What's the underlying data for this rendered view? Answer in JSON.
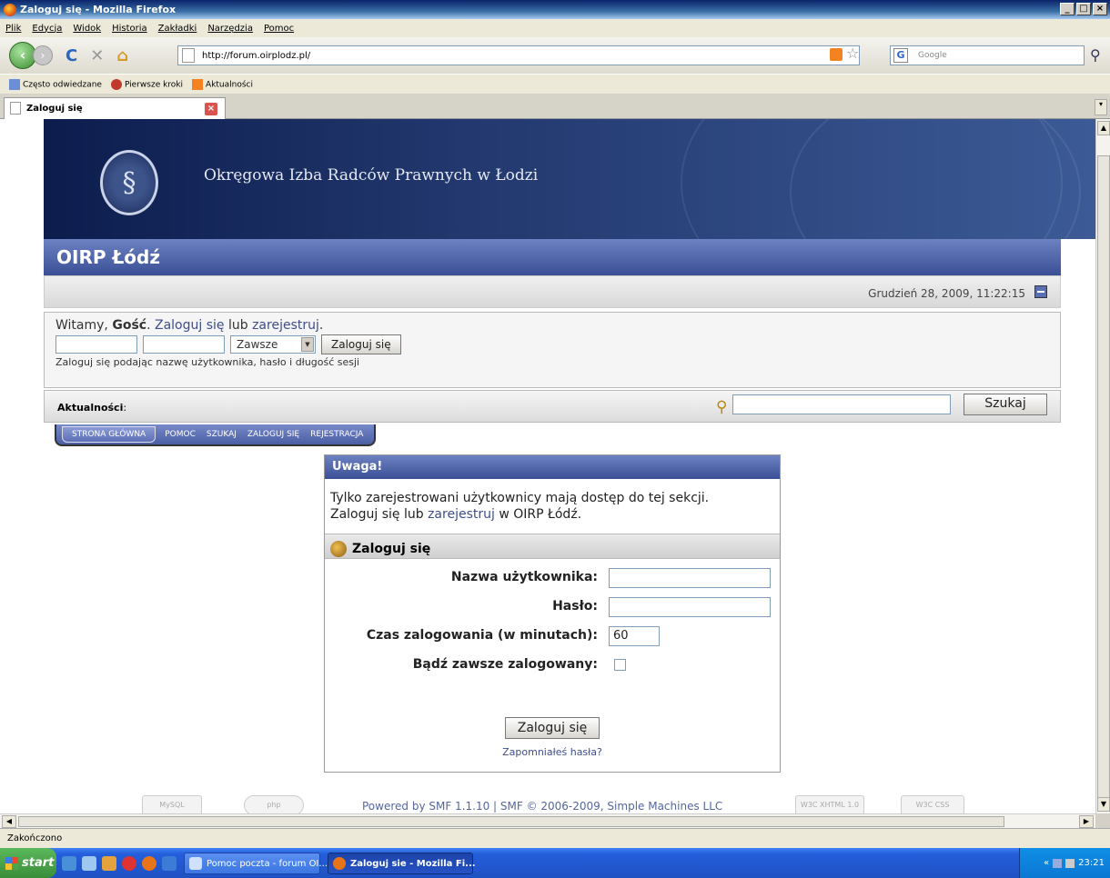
{
  "window": {
    "title": "Zaloguj się - Mozilla Firefox",
    "buttons": [
      "_",
      "□",
      "×"
    ]
  },
  "menu": [
    "Plik",
    "Edycja",
    "Widok",
    "Historia",
    "Zakładki",
    "Narzędzia",
    "Pomoc"
  ],
  "nav": {
    "url": "http://forum.oirplodz.pl/",
    "search_placeholder": "Google"
  },
  "bookmarks": [
    "Często odwiedzane",
    "Pierwsze kroki",
    "Aktualności"
  ],
  "tab": {
    "title": "Zaloguj się"
  },
  "banner": {
    "title": "Okręgowa Izba Radców Prawnych w Łodzi"
  },
  "forum": {
    "name": "OIRP Łódź",
    "date": "Grudzień 28, 2009, 11:22:15",
    "welcome_prefix": "Witamy, ",
    "guest": "Gość",
    "sep1": ". ",
    "login_link": "Zaloguj się",
    "or": " lub ",
    "register_link": "zarejestruj",
    "dot": ".",
    "session_option": "Zawsze",
    "quick_login_button": "Zaloguj się",
    "quick_login_hint": "Zaloguj się podając nazwę użytkownika, hasło i długość sesji",
    "news_label": "Aktualności",
    "news_colon": ":",
    "search_button": "Szukaj"
  },
  "menu_tabs": [
    "STRONA GŁÓWNA",
    "POMOC",
    "SZUKAJ",
    "ZALOGUJ SIĘ",
    "REJESTRACJA"
  ],
  "warning": {
    "title": "Uwaga!",
    "line1": "Tylko zarejestrowani użytkownicy mają dostęp do tej sekcji.",
    "line2_prefix": "Zaloguj się lub ",
    "line2_link": "zarejestruj",
    "line2_suffix": " w OIRP Łódź."
  },
  "login_form": {
    "header": "Zaloguj się",
    "username_label": "Nazwa użytkownika:",
    "password_label": "Hasło:",
    "session_label": "Czas zalogowania (w minutach):",
    "session_value": "60",
    "remember_label": "Bądź zawsze zalogowany:",
    "submit": "Zaloguj się",
    "forgot": "Zapomniałeś hasła?"
  },
  "footer": {
    "powered": "Powered by SMF 1.1.10 | SMF © 2006-2009, Simple Machines LLC",
    "badges": [
      "MySQL",
      "php",
      "W3C XHTML 1.0",
      "W3C CSS"
    ]
  },
  "status": "Zakończono",
  "taskbar": {
    "start": "start",
    "tasks": [
      "Pomoc poczta - forum OI...",
      "Zaloguj sie - Mozilla Fi..."
    ],
    "clock": "23:21"
  },
  "colors": {
    "forum_blue": "#3b4f95",
    "link": "#3e4d8c",
    "banner_dark": "#0c1c4d"
  }
}
